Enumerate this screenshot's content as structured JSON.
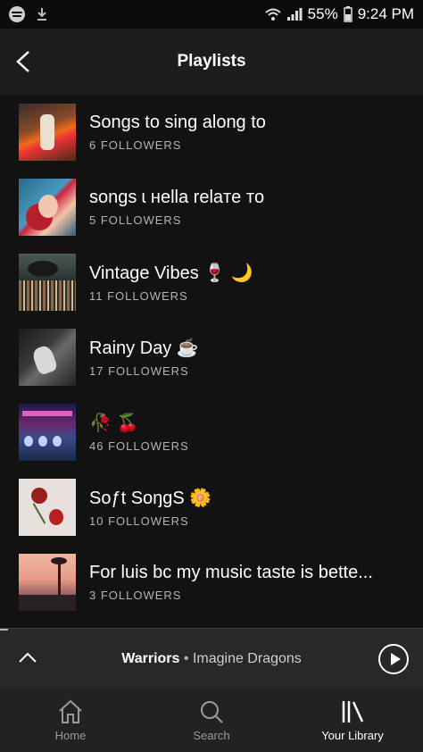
{
  "status_bar": {
    "battery": "55%",
    "time": "9:24 PM"
  },
  "header": {
    "title": "Playlists"
  },
  "playlists": [
    {
      "name": "Songs to sing along to",
      "followers": "6 FOLLOWERS"
    },
    {
      "name": "songs ɩ нella relaтe тo",
      "followers": "5 FOLLOWERS"
    },
    {
      "name": "Vintage Vibes 🍷 🌙",
      "followers": "11 FOLLOWERS"
    },
    {
      "name": "Rainy Day ☕",
      "followers": "17 FOLLOWERS"
    },
    {
      "name": "🥀 🍒",
      "followers": "46 FOLLOWERS"
    },
    {
      "name": "Soƒt SoŋgS 🌼",
      "followers": "10 FOLLOWERS"
    },
    {
      "name": "For luis bc my music taste is bette...",
      "followers": "3 FOLLOWERS"
    }
  ],
  "now_playing": {
    "title": "Warriors",
    "separator": "•",
    "artist": "Imagine Dragons",
    "progress": 0.02
  },
  "tabs": [
    {
      "label": "Home",
      "icon": "home-icon"
    },
    {
      "label": "Search",
      "icon": "search-icon"
    },
    {
      "label": "Your Library",
      "icon": "library-icon",
      "active": true
    }
  ]
}
